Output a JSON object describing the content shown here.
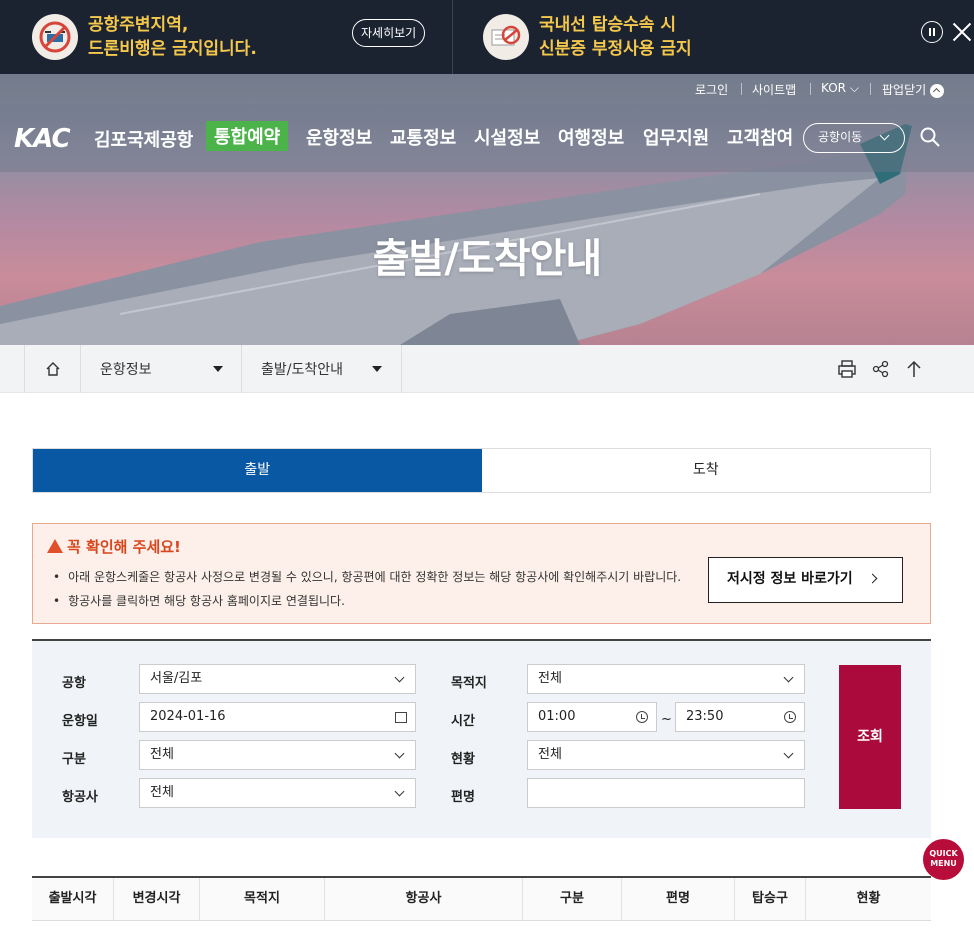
{
  "notices": [
    {
      "text": "공항주변지역,\n드론비행은 금지입니다.",
      "button": "자세히보기",
      "icon": "drone-prohibited-icon"
    },
    {
      "text": "국내선 탑승수속 시\n신분증 부정사용 금지",
      "icon": "id-card-prohibited-icon"
    }
  ],
  "util_nav": {
    "login": "로그인",
    "sitemap": "사이트맵",
    "lang": "KOR",
    "popup_close": "팝업닫기"
  },
  "brand": {
    "logo": "KAC",
    "name": "김포국제공항"
  },
  "gnb": [
    "통합예약",
    "운항정보",
    "교통정보",
    "시설정보",
    "여행정보",
    "업무지원",
    "고객참여"
  ],
  "airport_move": "공항이동",
  "hero_title": "출발/도착안내",
  "breadcrumb": {
    "level1": "운항정보",
    "level2": "출발/도착안내"
  },
  "tabs": {
    "departure": "출발",
    "arrival": "도착"
  },
  "alert": {
    "title": "꼭 확인해 주세요!",
    "items": [
      "아래 운항스케줄은 항공사 사정으로 변경될 수 있으니, 항공편에 대한 정확한 정보는 해당 항공사에 확인해주시기 바랍니다.",
      "항공사를 클릭하면 해당 항공사 홈페이지로 연결됩니다."
    ],
    "button": "저시정 정보 바로가기"
  },
  "form": {
    "airport_label": "공항",
    "airport_value": "서울/김포",
    "destination_label": "목적지",
    "destination_value": "전체",
    "date_label": "운항일",
    "date_value": "2024-01-16",
    "time_label": "시간",
    "time_from": "01:00",
    "time_sep": "~",
    "time_to": "23:50",
    "type_label": "구분",
    "type_value": "전체",
    "status_label": "현황",
    "status_value": "전체",
    "airline_label": "항공사",
    "airline_value": "전체",
    "flight_label": "편명",
    "flight_value": "",
    "search_button": "조회"
  },
  "quick_menu": "QUICK\nMENU",
  "table_headers": [
    "출발시각",
    "변경시각",
    "목적지",
    "항공사",
    "구분",
    "편명",
    "탑승구",
    "현황"
  ]
}
